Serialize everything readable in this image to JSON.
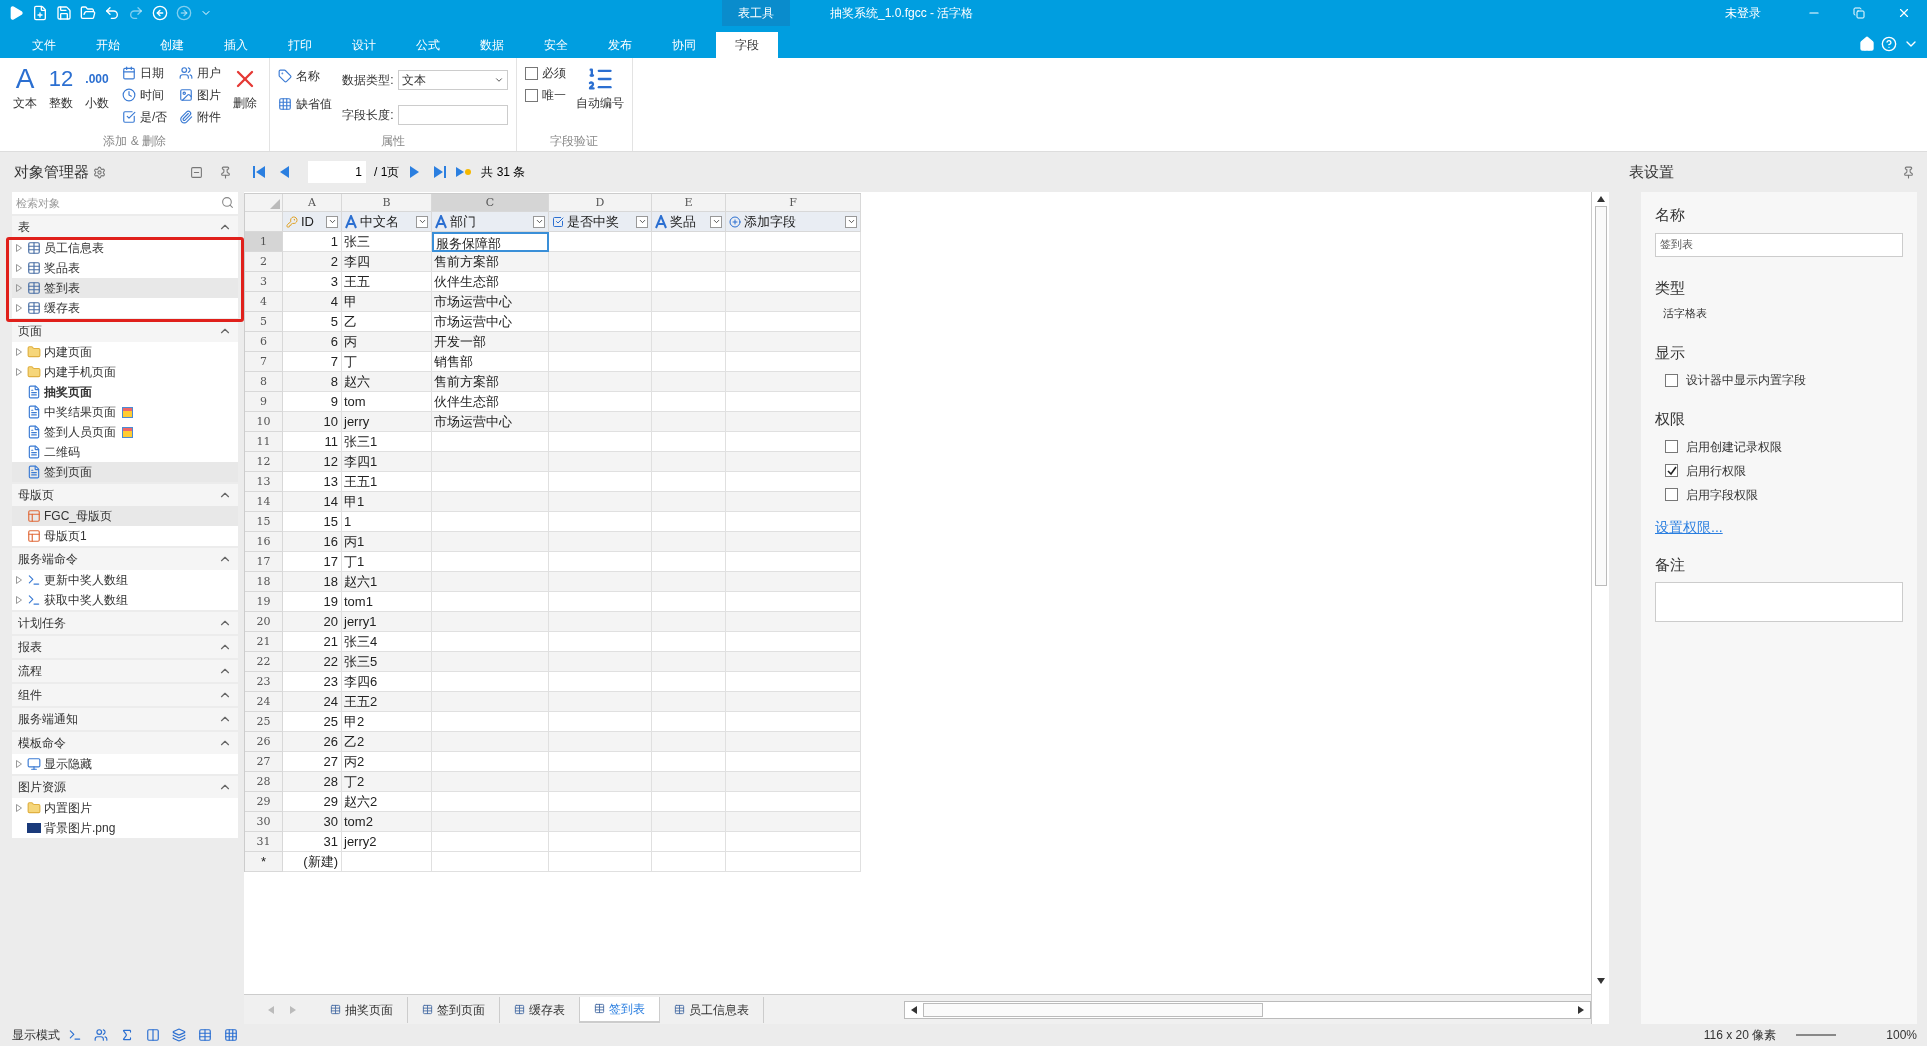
{
  "title_bar": {
    "context_tab": "表工具",
    "title": "抽奖系统_1.0.fgcc - 活字格",
    "user": "未登录"
  },
  "menu_tabs": [
    {
      "label": "文件",
      "selected": false
    },
    {
      "label": "开始",
      "selected": false
    },
    {
      "label": "创建",
      "selected": false
    },
    {
      "label": "插入",
      "selected": false
    },
    {
      "label": "打印",
      "selected": false
    },
    {
      "label": "设计",
      "selected": false
    },
    {
      "label": "公式",
      "selected": false
    },
    {
      "label": "数据",
      "selected": false
    },
    {
      "label": "安全",
      "selected": false
    },
    {
      "label": "发布",
      "selected": false
    },
    {
      "label": "协同",
      "selected": false
    },
    {
      "label": "字段",
      "selected": true
    }
  ],
  "ribbon": {
    "add_delete": {
      "big": [
        {
          "glyph": "A",
          "label": "文本"
        },
        {
          "glyph": "12",
          "label": "整数"
        },
        {
          "glyph": ".000",
          "label": "小数"
        }
      ],
      "small": [
        "日期",
        "时间",
        "是/否",
        "用户",
        "图片",
        "附件"
      ],
      "delete": "删除",
      "label": "添加 & 删除"
    },
    "properties": {
      "name_button": "名称",
      "default_button": "缺省值",
      "type_label": "数据类型:",
      "type_value": "文本",
      "length_label": "字段长度:",
      "label": "属性"
    },
    "validation": {
      "checks": [
        {
          "label": "必须",
          "checked": false
        },
        {
          "label": "唯一",
          "checked": false
        }
      ],
      "auto_number": "自动编号",
      "label": "字段验证"
    }
  },
  "sidebar": {
    "title": "对象管理器",
    "search": {
      "placeholder": "检索对象"
    },
    "sections": [
      {
        "title": "表",
        "expanded": true,
        "items": [
          {
            "label": "员工信息表",
            "kind": "table",
            "expandable": true,
            "selected": false
          },
          {
            "label": "奖品表",
            "kind": "table",
            "expandable": true,
            "selected": false
          },
          {
            "label": "签到表",
            "kind": "table",
            "expandable": true,
            "selected": true
          },
          {
            "label": "缓存表",
            "kind": "table",
            "expandable": true,
            "selected": false
          }
        ]
      },
      {
        "title": "页面",
        "expanded": true,
        "items": [
          {
            "label": "内建页面",
            "kind": "folder",
            "expandable": true,
            "selected": false
          },
          {
            "label": "内建手机页面",
            "kind": "folder",
            "expandable": true,
            "selected": false
          },
          {
            "label": "抽奖页面",
            "kind": "page",
            "expandable": false,
            "selected": false,
            "bold": true
          },
          {
            "label": "中奖结果页面",
            "kind": "page",
            "expandable": false,
            "selected": false,
            "badge": true
          },
          {
            "label": "签到人员页面",
            "kind": "page",
            "expandable": false,
            "selected": false,
            "badge": true
          },
          {
            "label": "二维码",
            "kind": "page",
            "expandable": false,
            "selected": false
          },
          {
            "label": "签到页面",
            "kind": "page",
            "expandable": false,
            "selected": true
          }
        ]
      },
      {
        "title": "母版页",
        "expanded": true,
        "items": [
          {
            "label": "FGC_母版页",
            "kind": "master",
            "expandable": false,
            "selected": true
          },
          {
            "label": "母版页1",
            "kind": "master",
            "expandable": false,
            "selected": false
          }
        ]
      },
      {
        "title": "服务端命令",
        "expanded": true,
        "items": [
          {
            "label": "更新中奖人数组",
            "kind": "command",
            "expandable": true,
            "selected": false
          },
          {
            "label": "获取中奖人数组",
            "kind": "command",
            "expandable": true,
            "selected": false
          }
        ]
      },
      {
        "title": "计划任务",
        "expanded": true
      },
      {
        "title": "报表",
        "expanded": true
      },
      {
        "title": "流程",
        "expanded": true
      },
      {
        "title": "组件",
        "expanded": true
      },
      {
        "title": "服务端通知",
        "expanded": true
      },
      {
        "title": "模板命令",
        "expanded": true,
        "items": [
          {
            "label": "显示隐藏",
            "kind": "template",
            "expandable": true,
            "selected": false
          }
        ]
      },
      {
        "title": "图片资源",
        "expanded": true,
        "items": [
          {
            "label": "内置图片",
            "kind": "folder",
            "expandable": true,
            "selected": false
          },
          {
            "label": "背景图片.png",
            "kind": "image",
            "expandable": false,
            "selected": false
          }
        ]
      }
    ]
  },
  "pager": {
    "page": "1",
    "pages": "/ 1页",
    "total": "共 31 条"
  },
  "grid": {
    "columns": [
      {
        "letter": "A",
        "field": "ID",
        "kind": "key",
        "selected": false
      },
      {
        "letter": "B",
        "field": "中文名",
        "kind": "text",
        "selected": false
      },
      {
        "letter": "C",
        "field": "部门",
        "kind": "text",
        "selected": true
      },
      {
        "letter": "D",
        "field": "是否中奖",
        "kind": "bool",
        "selected": false
      },
      {
        "letter": "E",
        "field": "奖品",
        "kind": "text",
        "selected": false
      },
      {
        "letter": "F",
        "field": "添加字段",
        "kind": "add",
        "selected": false
      }
    ],
    "rows": [
      {
        "n": "1",
        "cells": [
          "1",
          "张三",
          "服务保障部"
        ],
        "selected": true
      },
      {
        "n": "2",
        "cells": [
          "2",
          "李四",
          "售前方案部"
        ],
        "selected": false
      },
      {
        "n": "3",
        "cells": [
          "3",
          "王五",
          "伙伴生态部"
        ],
        "selected": false
      },
      {
        "n": "4",
        "cells": [
          "4",
          "甲",
          "市场运营中心"
        ],
        "selected": false
      },
      {
        "n": "5",
        "cells": [
          "5",
          "乙",
          "市场运营中心"
        ],
        "selected": false
      },
      {
        "n": "6",
        "cells": [
          "6",
          "丙",
          "开发一部"
        ],
        "selected": false
      },
      {
        "n": "7",
        "cells": [
          "7",
          "丁",
          "销售部"
        ],
        "selected": false
      },
      {
        "n": "8",
        "cells": [
          "8",
          "赵六",
          "售前方案部"
        ],
        "selected": false
      },
      {
        "n": "9",
        "cells": [
          "9",
          "tom",
          "伙伴生态部"
        ],
        "selected": false
      },
      {
        "n": "10",
        "cells": [
          "10",
          "jerry",
          "市场运营中心"
        ],
        "selected": false
      },
      {
        "n": "11",
        "cells": [
          "11",
          "张三1"
        ],
        "selected": false
      },
      {
        "n": "12",
        "cells": [
          "12",
          "李四1"
        ],
        "selected": false
      },
      {
        "n": "13",
        "cells": [
          "13",
          "王五1"
        ],
        "selected": false
      },
      {
        "n": "14",
        "cells": [
          "14",
          "甲1"
        ],
        "selected": false
      },
      {
        "n": "15",
        "cells": [
          "15",
          "1"
        ],
        "selected": false
      },
      {
        "n": "16",
        "cells": [
          "16",
          "丙1"
        ],
        "selected": false
      },
      {
        "n": "17",
        "cells": [
          "17",
          "丁1"
        ],
        "selected": false
      },
      {
        "n": "18",
        "cells": [
          "18",
          "赵六1"
        ],
        "selected": false
      },
      {
        "n": "19",
        "cells": [
          "19",
          "tom1"
        ],
        "selected": false
      },
      {
        "n": "20",
        "cells": [
          "20",
          "jerry1"
        ],
        "selected": false
      },
      {
        "n": "21",
        "cells": [
          "21",
          "张三4"
        ],
        "selected": false
      },
      {
        "n": "22",
        "cells": [
          "22",
          "张三5"
        ],
        "selected": false
      },
      {
        "n": "23",
        "cells": [
          "23",
          "李四6"
        ],
        "selected": false
      },
      {
        "n": "24",
        "cells": [
          "24",
          "王五2"
        ],
        "selected": false
      },
      {
        "n": "25",
        "cells": [
          "25",
          "甲2"
        ],
        "selected": false
      },
      {
        "n": "26",
        "cells": [
          "26",
          "乙2"
        ],
        "selected": false
      },
      {
        "n": "27",
        "cells": [
          "27",
          "丙2"
        ],
        "selected": false
      },
      {
        "n": "28",
        "cells": [
          "28",
          "丁2"
        ],
        "selected": false
      },
      {
        "n": "29",
        "cells": [
          "29",
          "赵六2"
        ],
        "selected": false
      },
      {
        "n": "30",
        "cells": [
          "30",
          "tom2"
        ],
        "selected": false
      },
      {
        "n": "31",
        "cells": [
          "31",
          "jerry2"
        ],
        "selected": false
      }
    ],
    "new_row": {
      "marker": "*",
      "label": "(新建)"
    }
  },
  "sheet_tabs": [
    {
      "label": "抽奖页面",
      "selected": false
    },
    {
      "label": "签到页面",
      "selected": false
    },
    {
      "label": "缓存表",
      "selected": false
    },
    {
      "label": "签到表",
      "selected": true
    },
    {
      "label": "员工信息表",
      "selected": false
    }
  ],
  "settings": {
    "title": "表设置",
    "name_label": "名称",
    "name_value": "签到表",
    "type_label": "类型",
    "type_value": "活字格表",
    "display_label": "显示",
    "display_checks": [
      {
        "label": "设计器中显示内置字段",
        "checked": false
      }
    ],
    "perm_label": "权限",
    "perm_checks": [
      {
        "label": "启用创建记录权限",
        "checked": false
      },
      {
        "label": "启用行权限",
        "checked": true
      },
      {
        "label": "启用字段权限",
        "checked": false
      }
    ],
    "perm_link": "设置权限...",
    "note_label": "备注"
  },
  "status_bar": {
    "mode": "显示模式",
    "size": "116 x 20 像素",
    "zoom": "100%"
  }
}
